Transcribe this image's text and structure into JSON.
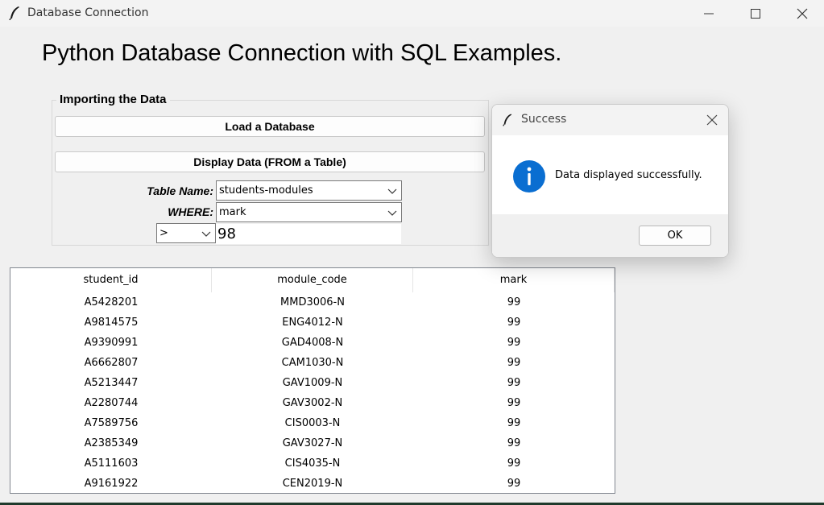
{
  "window": {
    "title": "Database Connection",
    "icon": "feather-icon"
  },
  "heading": "Python Database Connection with SQL Examples.",
  "import_group": {
    "title": "Importing the Data",
    "load_button": "Load a Database",
    "display_button": "Display Data (FROM a Table)",
    "table_name_label": "Table Name:",
    "table_name_value": "students-modules",
    "where_label": "WHERE:",
    "where_value": "mark",
    "operator_value": ">",
    "value_entry": "98"
  },
  "table": {
    "columns": [
      "student_id",
      "module_code",
      "mark"
    ],
    "rows": [
      [
        "A5428201",
        "MMD3006-N",
        "99"
      ],
      [
        "A9814575",
        "ENG4012-N",
        "99"
      ],
      [
        "A9390991",
        "GAD4008-N",
        "99"
      ],
      [
        "A6662807",
        "CAM1030-N",
        "99"
      ],
      [
        "A5213447",
        "GAV1009-N",
        "99"
      ],
      [
        "A2280744",
        "GAV3002-N",
        "99"
      ],
      [
        "A7589756",
        "CIS0003-N",
        "99"
      ],
      [
        "A2385349",
        "GAV3027-N",
        "99"
      ],
      [
        "A5111603",
        "CIS4035-N",
        "99"
      ],
      [
        "A9161922",
        "CEN2019-N",
        "99"
      ]
    ]
  },
  "dialog": {
    "title": "Success",
    "message": "Data displayed successfully.",
    "ok_label": "OK",
    "icon": "info-icon",
    "info_color": "#0a6ed1"
  }
}
